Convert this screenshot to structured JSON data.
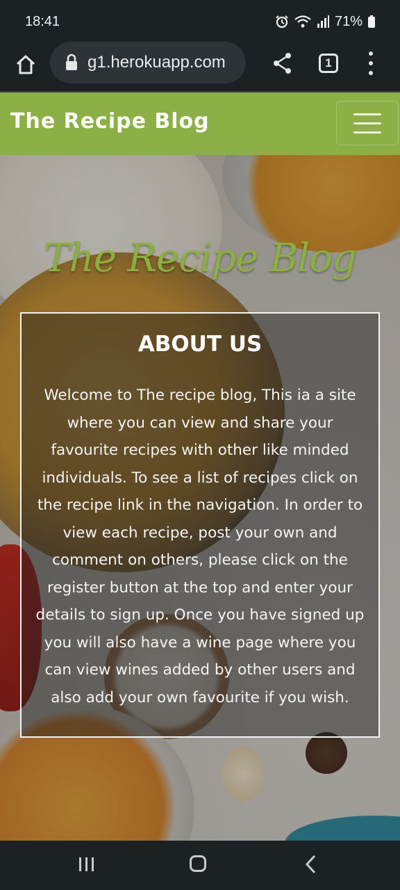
{
  "status_bar": {
    "time": "18:41",
    "battery": "71%",
    "icons": [
      "alarm-icon",
      "wifi-icon",
      "signal-icon",
      "battery-icon"
    ]
  },
  "browser": {
    "url": "g1.herokuapp.com",
    "tab_count": "1",
    "icons": [
      "home-icon",
      "lock-icon",
      "share-icon",
      "tabs-icon",
      "more-icon"
    ]
  },
  "navbar": {
    "brand": "The Recipe Blog",
    "toggler_icon": "hamburger-icon"
  },
  "hero": {
    "title": "The Recipe Blog"
  },
  "about": {
    "heading": "ABOUT US",
    "text": "Welcome to The recipe blog, This ia a site where you can view and share your favourite recipes with other like minded individuals. To see a list of recipes click on the recipe link in the navigation. In order to view each recipe, post your own and comment on others, please click on the register button at the top and enter your details to sign up. Once you have signed up you will also have a wine page where you can view wines added by other users and also add your own favourite if you wish."
  },
  "system_nav": {
    "icons": [
      "recents-icon",
      "home-circle-icon",
      "back-icon"
    ]
  },
  "colors": {
    "navbar_green": "#8cb045",
    "title_green": "#8bb040",
    "system_bar": "#1c2124"
  }
}
